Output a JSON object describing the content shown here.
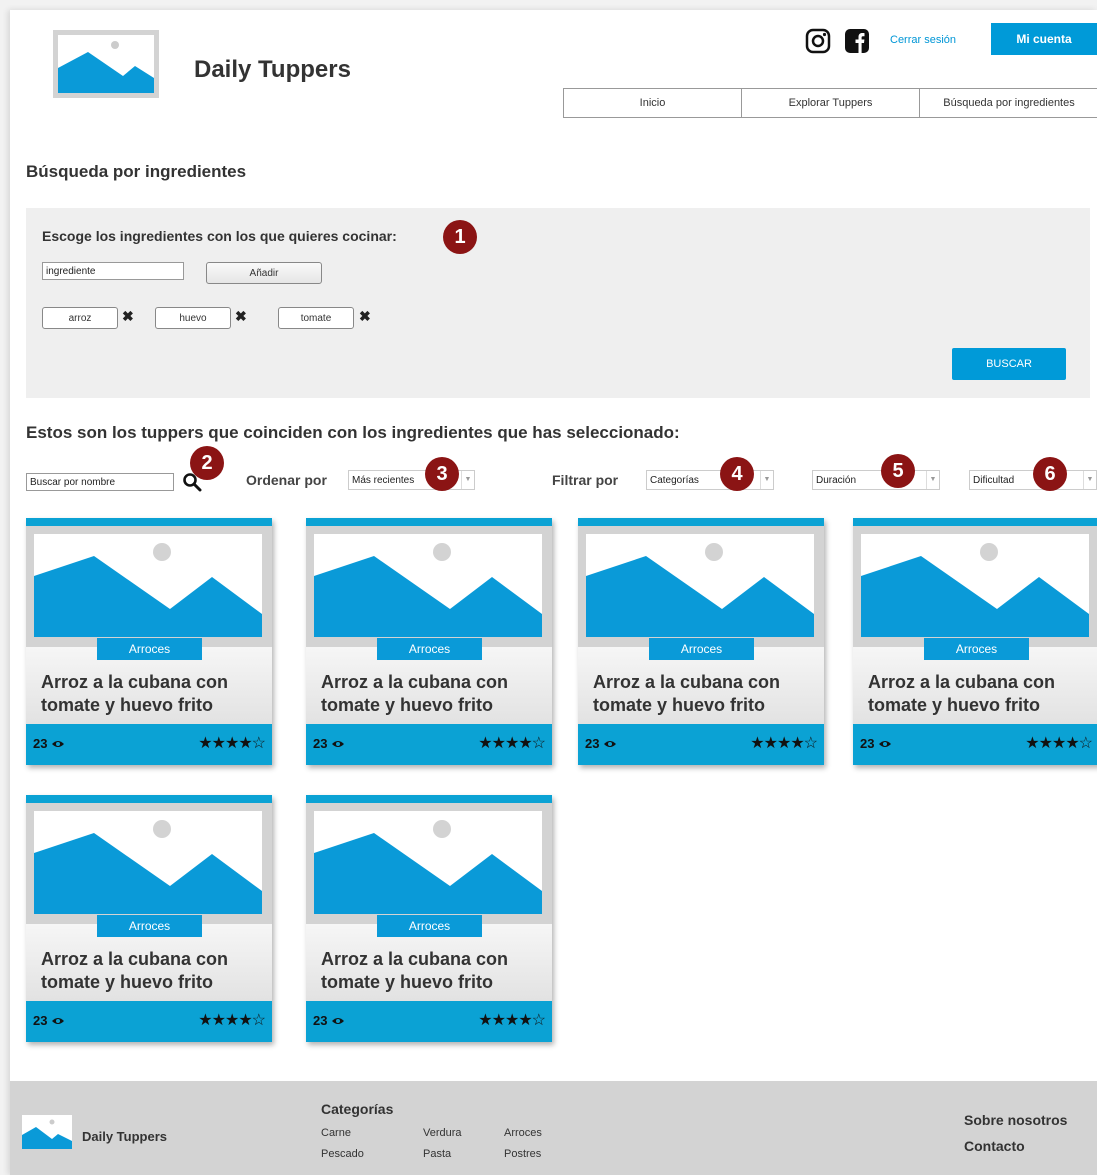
{
  "header": {
    "site_title": "Daily Tuppers",
    "logout_label": "Cerrar sesión",
    "account_label": "Mi cuenta",
    "social_icons": [
      "instagram-icon",
      "facebook-icon"
    ],
    "nav": [
      "Inicio",
      "Explorar Tuppers",
      "Búsqueda por ingredientes"
    ]
  },
  "page_title": "Búsqueda por ingredientes",
  "ingredients_panel": {
    "label": "Escoge los ingredientes con los que quieres cocinar:",
    "input_value": "ingrediente",
    "add_label": "Añadir",
    "chips": [
      "arroz",
      "huevo",
      "tomate"
    ],
    "remove_symbol": "✖",
    "search_label": "BUSCAR"
  },
  "results": {
    "heading": "Estos son los tuppers que coinciden con los ingredientes que has seleccionado:",
    "name_search_value": "Buscar por nombre",
    "sort_label": "Ordenar por",
    "sort_value": "Más recientes",
    "filter_label": "Filtrar por",
    "filters": [
      "Categorías",
      "Duración",
      "Dificultad"
    ]
  },
  "annotation_numbers": [
    "1",
    "2",
    "3",
    "4",
    "5",
    "6"
  ],
  "cards": [
    {
      "category": "Arroces",
      "title": "Arroz a la cubana con tomate y huevo frito",
      "views": "23",
      "stars": "★★★★☆",
      "rating": 4
    },
    {
      "category": "Arroces",
      "title": "Arroz a la cubana con tomate y huevo frito",
      "views": "23",
      "stars": "★★★★☆",
      "rating": 4
    },
    {
      "category": "Arroces",
      "title": "Arroz a la cubana con tomate y huevo frito",
      "views": "23",
      "stars": "★★★★☆",
      "rating": 4
    },
    {
      "category": "Arroces",
      "title": "Arroz a la cubana con tomate y huevo frito",
      "views": "23",
      "stars": "★★★★☆",
      "rating": 4
    },
    {
      "category": "Arroces",
      "title": "Arroz a la cubana con tomate y huevo frito",
      "views": "23",
      "stars": "★★★★☆",
      "rating": 4
    },
    {
      "category": "Arroces",
      "title": "Arroz a la cubana con tomate y huevo frito",
      "views": "23",
      "stars": "★★★★☆",
      "rating": 4
    }
  ],
  "footer": {
    "site_name": "Daily Tuppers",
    "categories_title": "Categorías",
    "categories": [
      "Carne",
      "Verdura",
      "Arroces",
      "Pescado",
      "Pasta",
      "Postres"
    ],
    "about": "Sobre nosotros",
    "contact": "Contacto"
  },
  "colors": {
    "accent": "#009ad8",
    "annotation": "#8b1414",
    "panel_bg": "#efefef",
    "footer_bg": "#d3d3d3"
  }
}
